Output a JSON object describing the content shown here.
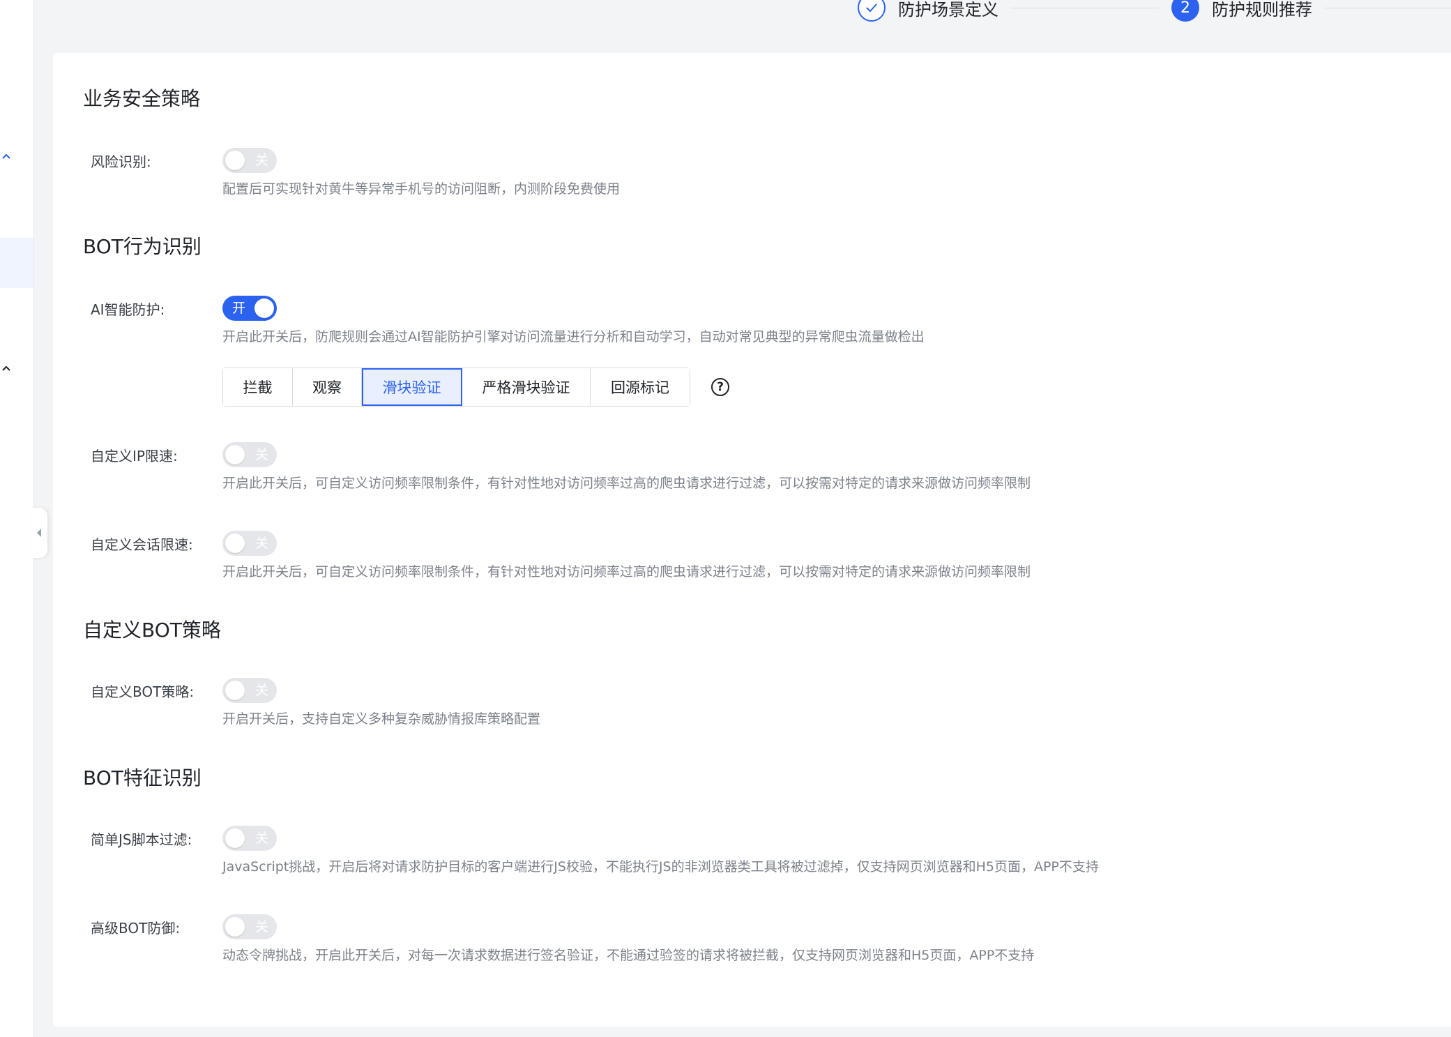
{
  "steps": [
    {
      "label": "防护场景定义",
      "state": "done",
      "icon": "check-icon"
    },
    {
      "number": "2",
      "label": "防护规则推荐",
      "state": "active"
    }
  ],
  "sections": {
    "business": {
      "title": "业务安全策略",
      "risk": {
        "label": "风险识别:",
        "switch_text": "关",
        "on": false,
        "desc": "配置后可实现针对黄牛等异常手机号的访问阻断，内测阶段免费使用"
      }
    },
    "bot_behavior": {
      "title": "BOT行为识别",
      "ai": {
        "label": "AI智能防护:",
        "switch_text": "开",
        "on": true,
        "desc": "开启此开关后，防爬规则会通过AI智能防护引擎对访问流量进行分析和自动学习，自动对常见典型的异常爬虫流量做检出"
      },
      "actions": [
        "拦截",
        "观察",
        "滑块验证",
        "严格滑块验证",
        "回源标记"
      ],
      "selected_action": "滑块验证",
      "help_glyph": "?",
      "ip_limit": {
        "label": "自定义IP限速:",
        "switch_text": "关",
        "on": false,
        "desc": "开启此开关后，可自定义访问频率限制条件，有针对性地对访问频率过高的爬虫请求进行过滤，可以按需对特定的请求来源做访问频率限制"
      },
      "session_limit": {
        "label": "自定义会话限速:",
        "switch_text": "关",
        "on": false,
        "desc": "开启此开关后，可自定义访问频率限制条件，有针对性地对访问频率过高的爬虫请求进行过滤，可以按需对特定的请求来源做访问频率限制"
      }
    },
    "custom_bot": {
      "title": "自定义BOT策略",
      "policy": {
        "label": "自定义BOT策略:",
        "switch_text": "关",
        "on": false,
        "desc": "开启开关后，支持自定义多种复杂威胁情报库策略配置"
      }
    },
    "bot_feature": {
      "title": "BOT特征识别",
      "js_filter": {
        "label": "简单JS脚本过滤:",
        "switch_text": "关",
        "on": false,
        "desc": "JavaScript挑战，开启后将对请求防护目标的客户端进行JS校验，不能执行JS的非浏览器类工具将被过滤掉，仅支持网页浏览器和H5页面，APP不支持"
      },
      "advanced": {
        "label": "高级BOT防御:",
        "switch_text": "关",
        "on": false,
        "desc": "动态令牌挑战，开启此开关后，对每一次请求数据进行签名验证，不能通过验签的请求将被拦截，仅支持网页浏览器和H5页面，APP不支持"
      }
    }
  },
  "colors": {
    "accent": "#2b63f0",
    "switch_off": "#e4e6ea",
    "desc_text": "#7c828b"
  }
}
